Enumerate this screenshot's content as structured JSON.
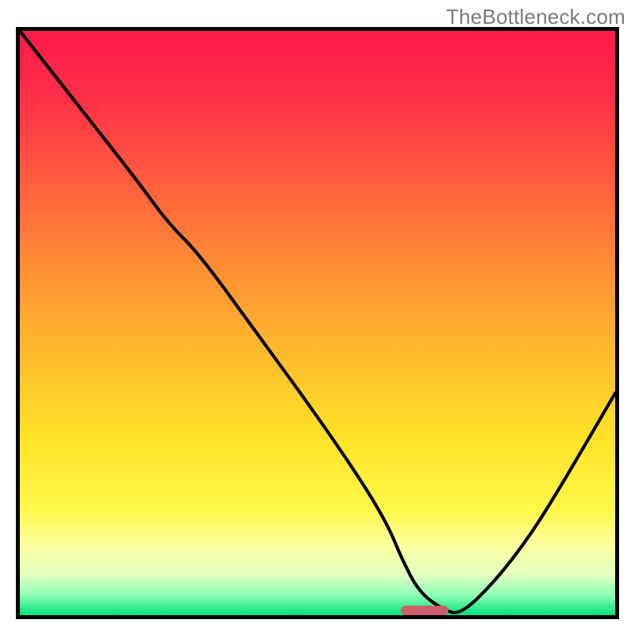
{
  "watermark": "TheBottleneck.com",
  "chart_data": {
    "type": "line",
    "title": "",
    "xlabel": "",
    "ylabel": "",
    "xlim": [
      0,
      100
    ],
    "ylim": [
      0,
      100
    ],
    "grid": false,
    "background_gradient": {
      "stops": [
        {
          "offset": 0.0,
          "color": "#ff1a4b"
        },
        {
          "offset": 0.12,
          "color": "#ff3047"
        },
        {
          "offset": 0.25,
          "color": "#ff5a3e"
        },
        {
          "offset": 0.4,
          "color": "#ff8c34"
        },
        {
          "offset": 0.55,
          "color": "#ffba2c"
        },
        {
          "offset": 0.7,
          "color": "#ffe328"
        },
        {
          "offset": 0.82,
          "color": "#fff84a"
        },
        {
          "offset": 0.88,
          "color": "#fdff9e"
        },
        {
          "offset": 0.93,
          "color": "#e3ffbf"
        },
        {
          "offset": 0.965,
          "color": "#90ffb8"
        },
        {
          "offset": 1.0,
          "color": "#00e27a"
        }
      ]
    },
    "series": [
      {
        "name": "bottleneck-curve",
        "x": [
          0,
          10,
          20,
          25,
          30,
          40,
          50,
          58,
          62,
          64,
          67,
          71,
          74,
          80,
          86,
          92,
          100
        ],
        "y": [
          100,
          87,
          74,
          67,
          62,
          48,
          34,
          22,
          15,
          10,
          4,
          1,
          0,
          6,
          14,
          24,
          38
        ]
      }
    ],
    "marker": {
      "name": "optimal-marker",
      "x_start": 64,
      "x_end": 72,
      "y": 0.2,
      "color": "#cb5f69"
    }
  }
}
